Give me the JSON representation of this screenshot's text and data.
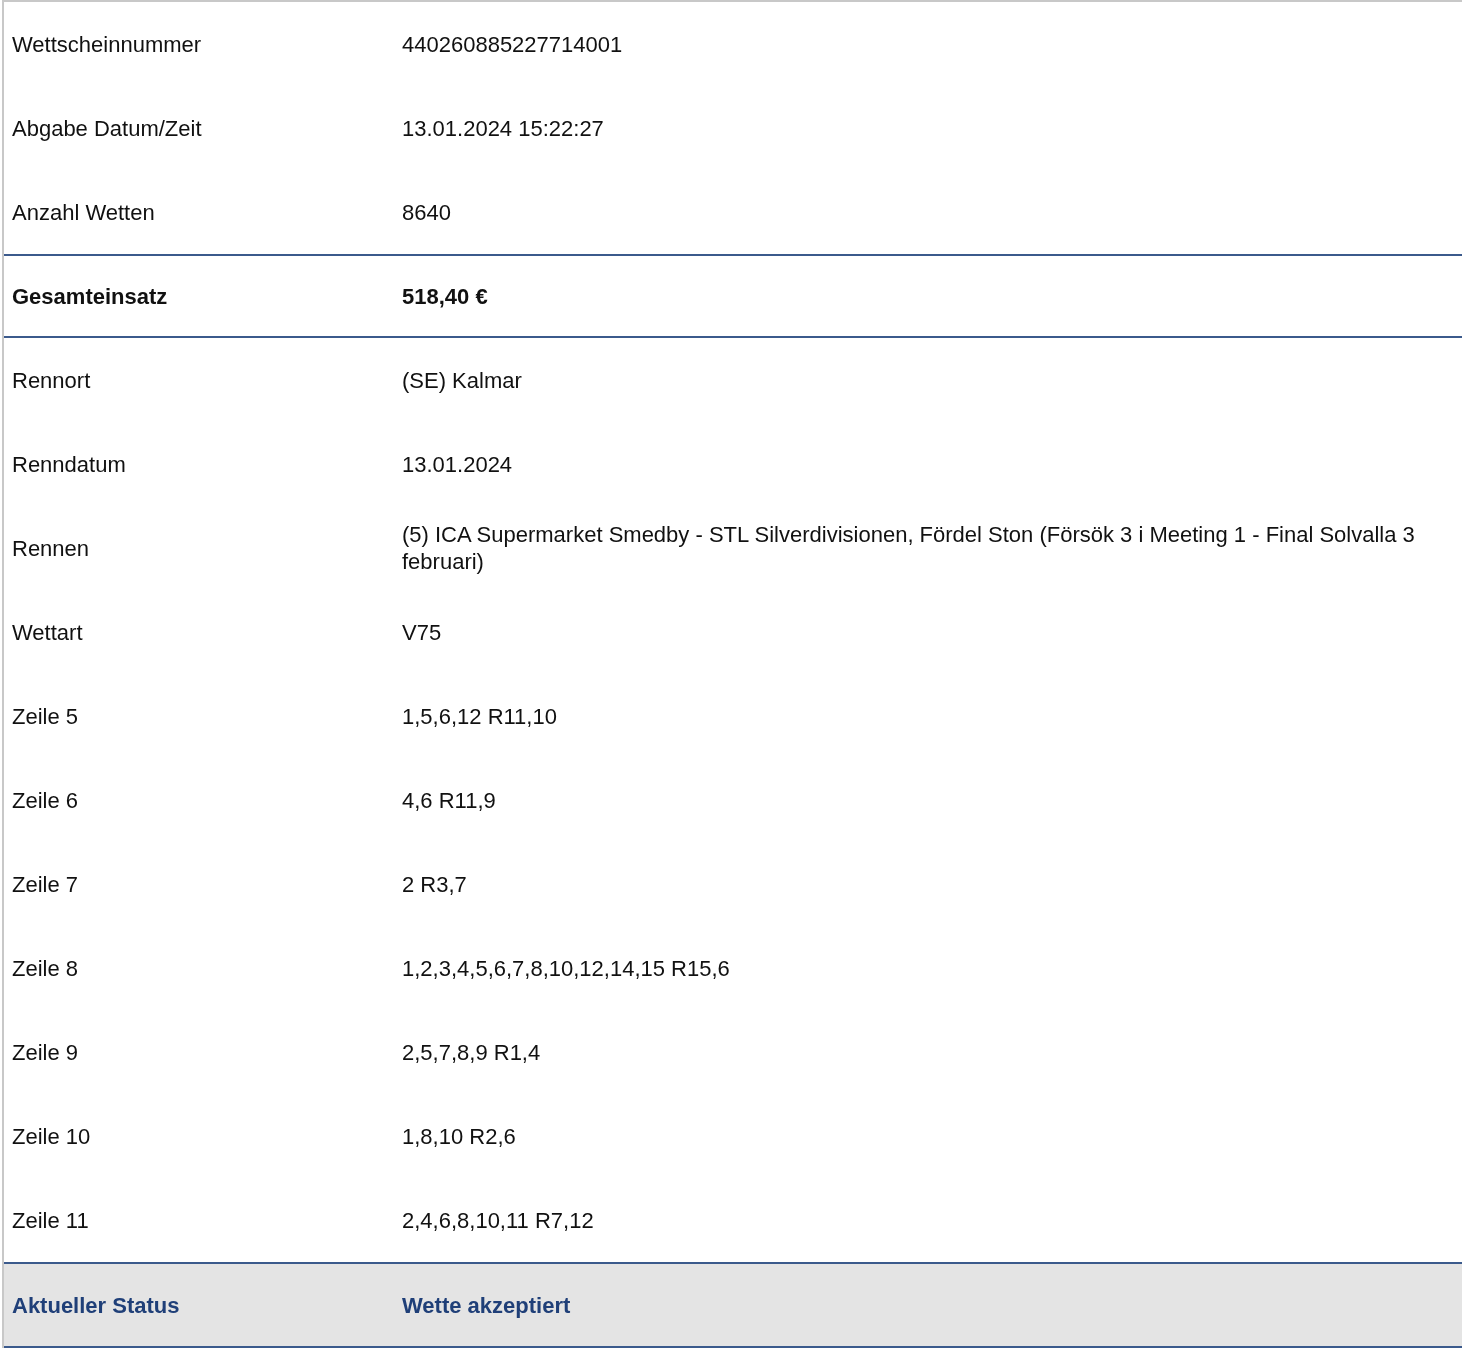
{
  "rows": [
    {
      "kind": "normal",
      "label": "Wettscheinnummer",
      "value": "440260885227714001"
    },
    {
      "kind": "normal",
      "label": "Abgabe Datum/Zeit",
      "value": "13.01.2024 15:22:27"
    },
    {
      "kind": "normal",
      "label": "Anzahl Wetten",
      "value": "8640"
    },
    {
      "kind": "total",
      "label": "Gesamteinsatz",
      "value": "518,40 €"
    },
    {
      "kind": "normal",
      "label": "Rennort",
      "value": "(SE) Kalmar"
    },
    {
      "kind": "normal",
      "label": "Renndatum",
      "value": "13.01.2024"
    },
    {
      "kind": "normal",
      "label": "Rennen",
      "value": "(5) ICA Supermarket Smedby - STL Silverdivisionen, Fördel Ston (Försök 3 i Meeting 1 - Final Solvalla 3 februari)"
    },
    {
      "kind": "normal",
      "label": "Wettart",
      "value": "V75"
    },
    {
      "kind": "normal",
      "label": "Zeile 5",
      "value": "1,5,6,12 R11,10"
    },
    {
      "kind": "normal",
      "label": "Zeile 6",
      "value": "4,6 R11,9"
    },
    {
      "kind": "normal",
      "label": "Zeile 7",
      "value": "2 R3,7"
    },
    {
      "kind": "normal",
      "label": "Zeile 8",
      "value": "1,2,3,4,5,6,7,8,10,12,14,15 R15,6"
    },
    {
      "kind": "normal",
      "label": "Zeile 9",
      "value": "2,5,7,8,9 R1,4"
    },
    {
      "kind": "normal",
      "label": "Zeile 10",
      "value": "1,8,10 R2,6"
    },
    {
      "kind": "normal",
      "label": "Zeile 11",
      "value": "2,4,6,8,10,11 R7,12"
    },
    {
      "kind": "status",
      "label": "Aktueller Status",
      "value": "Wette akzeptiert"
    }
  ]
}
